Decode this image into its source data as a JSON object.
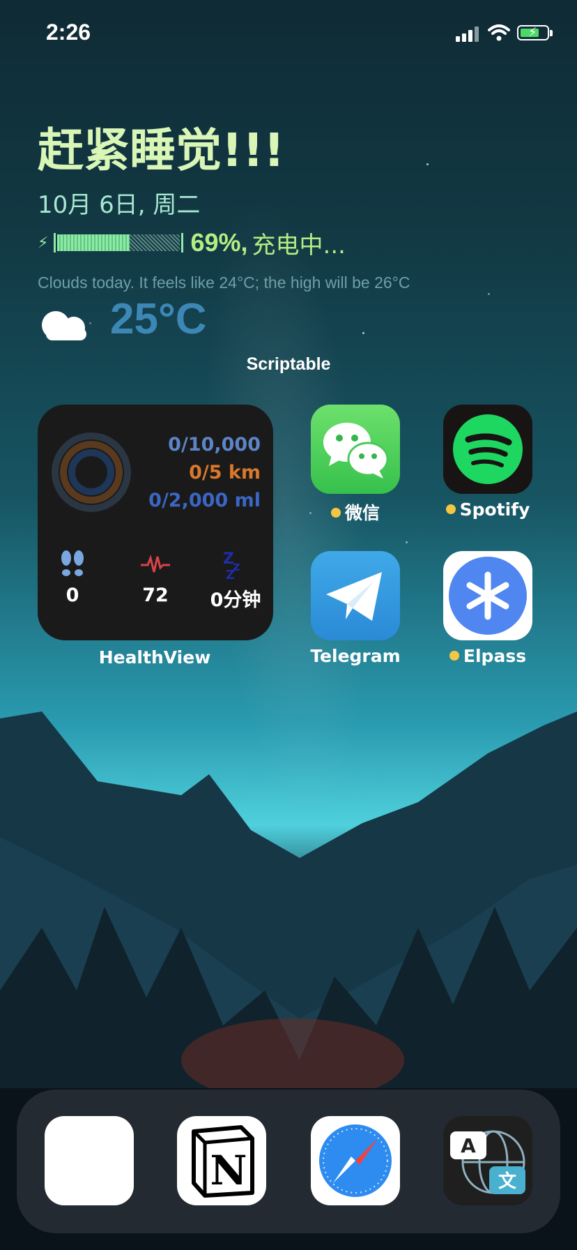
{
  "status_bar": {
    "time": "2:26"
  },
  "scriptable_widget": {
    "title": "赶紧睡觉!!!",
    "date": "10月 6日, 周二",
    "battery_level": 0.69,
    "battery_percent": "69%,",
    "battery_status": "充电中...",
    "weather_summary": "Clouds today. It feels like 24°C; the high will be 26°C",
    "temperature": "25°C",
    "widget_label": "Scriptable"
  },
  "health_widget": {
    "steps_goal": "0/10,000",
    "distance_goal": "0/5 km",
    "water_goal": "0/2,000 ml",
    "steps": "0",
    "heart_rate": "72",
    "sleep": "0分钟",
    "label": "HealthView"
  },
  "apps": [
    {
      "label": "微信",
      "icon": "wechat-icon",
      "new": true
    },
    {
      "label": "Spotify",
      "icon": "spotify-icon",
      "new": true
    },
    {
      "label": "Telegram",
      "icon": "telegram-icon",
      "new": false
    },
    {
      "label": "Elpass",
      "icon": "elpass-icon",
      "new": true
    }
  ],
  "dock": [
    {
      "icon": "voice-memos-app-icon"
    },
    {
      "icon": "notion-icon"
    },
    {
      "icon": "safari-icon"
    },
    {
      "icon": "translate-icon"
    }
  ],
  "colors": {
    "accent_green": "#b4ee83",
    "title": "#d9f6b7",
    "badge_dot": "#f4c742"
  }
}
